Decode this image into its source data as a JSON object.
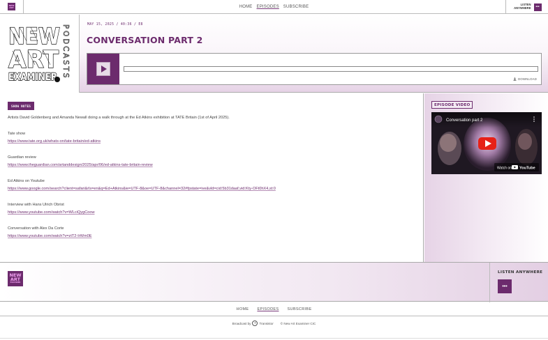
{
  "header": {
    "logo_lines": [
      "NEW",
      "ART",
      "EXAMINER"
    ],
    "nav": [
      {
        "label": "HOME",
        "active": false
      },
      {
        "label": "EPISODES",
        "active": true
      },
      {
        "label": "SUBSCRIBE",
        "active": false
      }
    ],
    "listen_label": "LISTEN ANYWHERE",
    "more_label": "•••"
  },
  "cover": {
    "title_lines": [
      "NEW",
      "ART",
      "EXAMINER"
    ],
    "side_text": "PODCASTS"
  },
  "episode": {
    "meta": "MAY 15, 2025 / 40:36 / E8",
    "title": "CONVERSATION PART 2",
    "download_label": "DOWNLOAD",
    "progress": 0
  },
  "notes": {
    "button_label": "SHOW NOTES",
    "intro": "Artists David Goldenberg and Amanda Newall doing a walk through at the Ed Atkins exhibition at TATE Britain (1st of April 2025).",
    "items": [
      {
        "title": "Tate show",
        "url": "https://www.tate.org.uk/whats-on/tate-britain/ed-atkins"
      },
      {
        "title": "Guardian review",
        "url": "https://www.theguardian.com/artanddesign/2025/apr/06/ed-atkins-tate-britain-review"
      },
      {
        "title": "Ed Atkins on Youtube",
        "url": "https://www.google.com/search?client=safari&rls=en&q=Ed+Atkins&ie=UTF-8&oe=UTF-8&channel=32#fpstate=ive&vld=cid:5b31daaf,vid:Kty-OFt0hX4,st:0"
      },
      {
        "title": "Interview with Hans Ulrich Obrist",
        "url": "https://www.youtube.com/watch?v=WLciQygCoow"
      },
      {
        "title": "Conversation with Alex Da Corte",
        "url": "https://www.youtube.com/watch?v=ztT2-IrWm0E"
      }
    ]
  },
  "sidebar": {
    "video_label": "EPISODE VIDEO",
    "video_title": "Conversation part 2",
    "watch_on": "Watch on",
    "youtube": "YouTube"
  },
  "footer": {
    "logo_lines": [
      "NEW",
      "ART",
      "EXAMINER"
    ],
    "listen_title": "LISTEN ANYWHERE",
    "more_label": "•••",
    "nav": [
      {
        "label": "HOME",
        "active": false
      },
      {
        "label": "EPISODES",
        "active": true
      },
      {
        "label": "SUBSCRIBE",
        "active": false
      }
    ],
    "broadcast_by": "Broadcast by",
    "transistor": "Transistor",
    "copyright": "© New Art Examiner CIC"
  },
  "colors": {
    "accent": "#6c2b6d",
    "accent_light": "#e6d3e6"
  }
}
